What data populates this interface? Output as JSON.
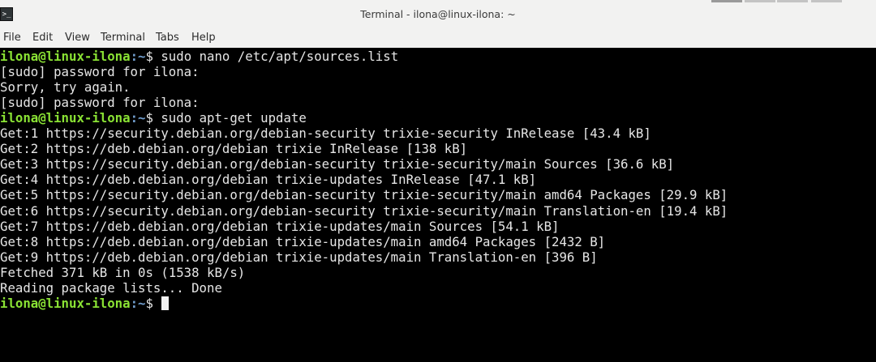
{
  "window": {
    "title": "Terminal - ilona@linux-ilona: ~",
    "icon": "terminal-icon",
    "icon_glyph": ">_"
  },
  "menubar": {
    "items": [
      "File",
      "Edit",
      "View",
      "Terminal",
      "Tabs",
      "Help"
    ]
  },
  "colors": {
    "background": "#000000",
    "text": "#e6e6e6",
    "prompt_user": "#8ae234",
    "prompt_path": "#729fcf",
    "chrome": "#f2f2f1"
  },
  "terminal": {
    "prompt": {
      "user_host": "ilona@linux-ilona",
      "sep": ":",
      "path": "~",
      "symbol": "$ "
    },
    "lines": [
      {
        "prompt": true,
        "text": "sudo nano /etc/apt/sources.list"
      },
      {
        "prompt": false,
        "text": "[sudo] password for ilona:"
      },
      {
        "prompt": false,
        "text": "Sorry, try again."
      },
      {
        "prompt": false,
        "text": "[sudo] password for ilona:"
      },
      {
        "prompt": true,
        "text": "sudo apt-get update"
      },
      {
        "prompt": false,
        "text": "Get:1 https://security.debian.org/debian-security trixie-security InRelease [43.4 kB]"
      },
      {
        "prompt": false,
        "text": "Get:2 https://deb.debian.org/debian trixie InRelease [138 kB]"
      },
      {
        "prompt": false,
        "text": "Get:3 https://security.debian.org/debian-security trixie-security/main Sources [36.6 kB]"
      },
      {
        "prompt": false,
        "text": "Get:4 https://deb.debian.org/debian trixie-updates InRelease [47.1 kB]"
      },
      {
        "prompt": false,
        "text": "Get:5 https://security.debian.org/debian-security trixie-security/main amd64 Packages [29.9 kB]"
      },
      {
        "prompt": false,
        "text": "Get:6 https://security.debian.org/debian-security trixie-security/main Translation-en [19.4 kB]"
      },
      {
        "prompt": false,
        "text": "Get:7 https://deb.debian.org/debian trixie-updates/main Sources [54.1 kB]"
      },
      {
        "prompt": false,
        "text": "Get:8 https://deb.debian.org/debian trixie-updates/main amd64 Packages [2432 B]"
      },
      {
        "prompt": false,
        "text": "Get:9 https://deb.debian.org/debian trixie-updates/main Translation-en [396 B]"
      },
      {
        "prompt": false,
        "text": "Fetched 371 kB in 0s (1538 kB/s)"
      },
      {
        "prompt": false,
        "text": "Reading package lists... Done"
      },
      {
        "prompt": true,
        "text": "",
        "cursor": true
      }
    ]
  }
}
